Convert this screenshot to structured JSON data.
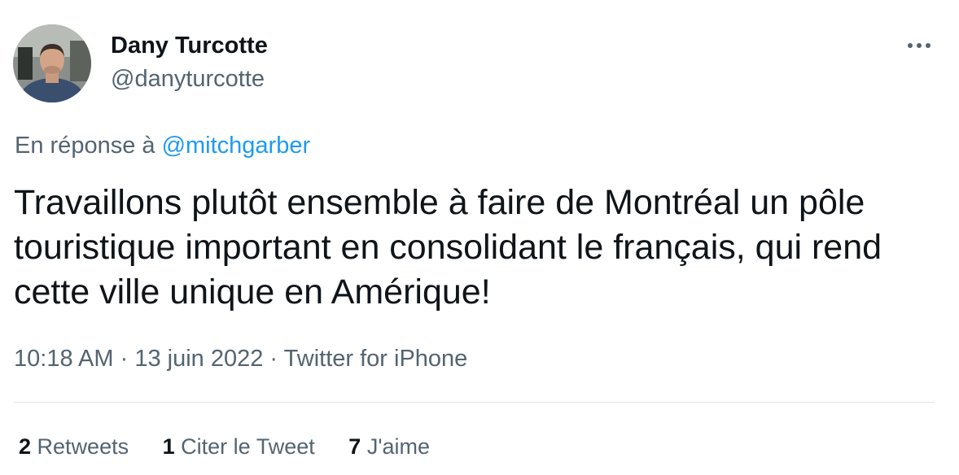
{
  "author": {
    "name": "Dany Turcotte",
    "handle": "@danyturcotte"
  },
  "reply": {
    "prefix": "En réponse à",
    "mention": "@mitchgarber"
  },
  "tweet": {
    "text": "Travaillons plutôt ensemble à faire de Montréal un pôle touristique important en consolidant le français, qui rend cette ville unique en Amérique!"
  },
  "meta": {
    "time": "10:18 AM",
    "separator": "·",
    "date": "13 juin 2022",
    "source": "Twitter for iPhone"
  },
  "stats": {
    "retweets_count": "2",
    "retweets_label": "Retweets",
    "quotes_count": "1",
    "quotes_label": "Citer le Tweet",
    "likes_count": "7",
    "likes_label": "J'aime"
  },
  "icons": {
    "more": "more-horizontal-icon"
  },
  "colors": {
    "text": "#0f1419",
    "secondary": "#536471",
    "link": "#1d9bf0",
    "divider": "#e1e6ea"
  }
}
